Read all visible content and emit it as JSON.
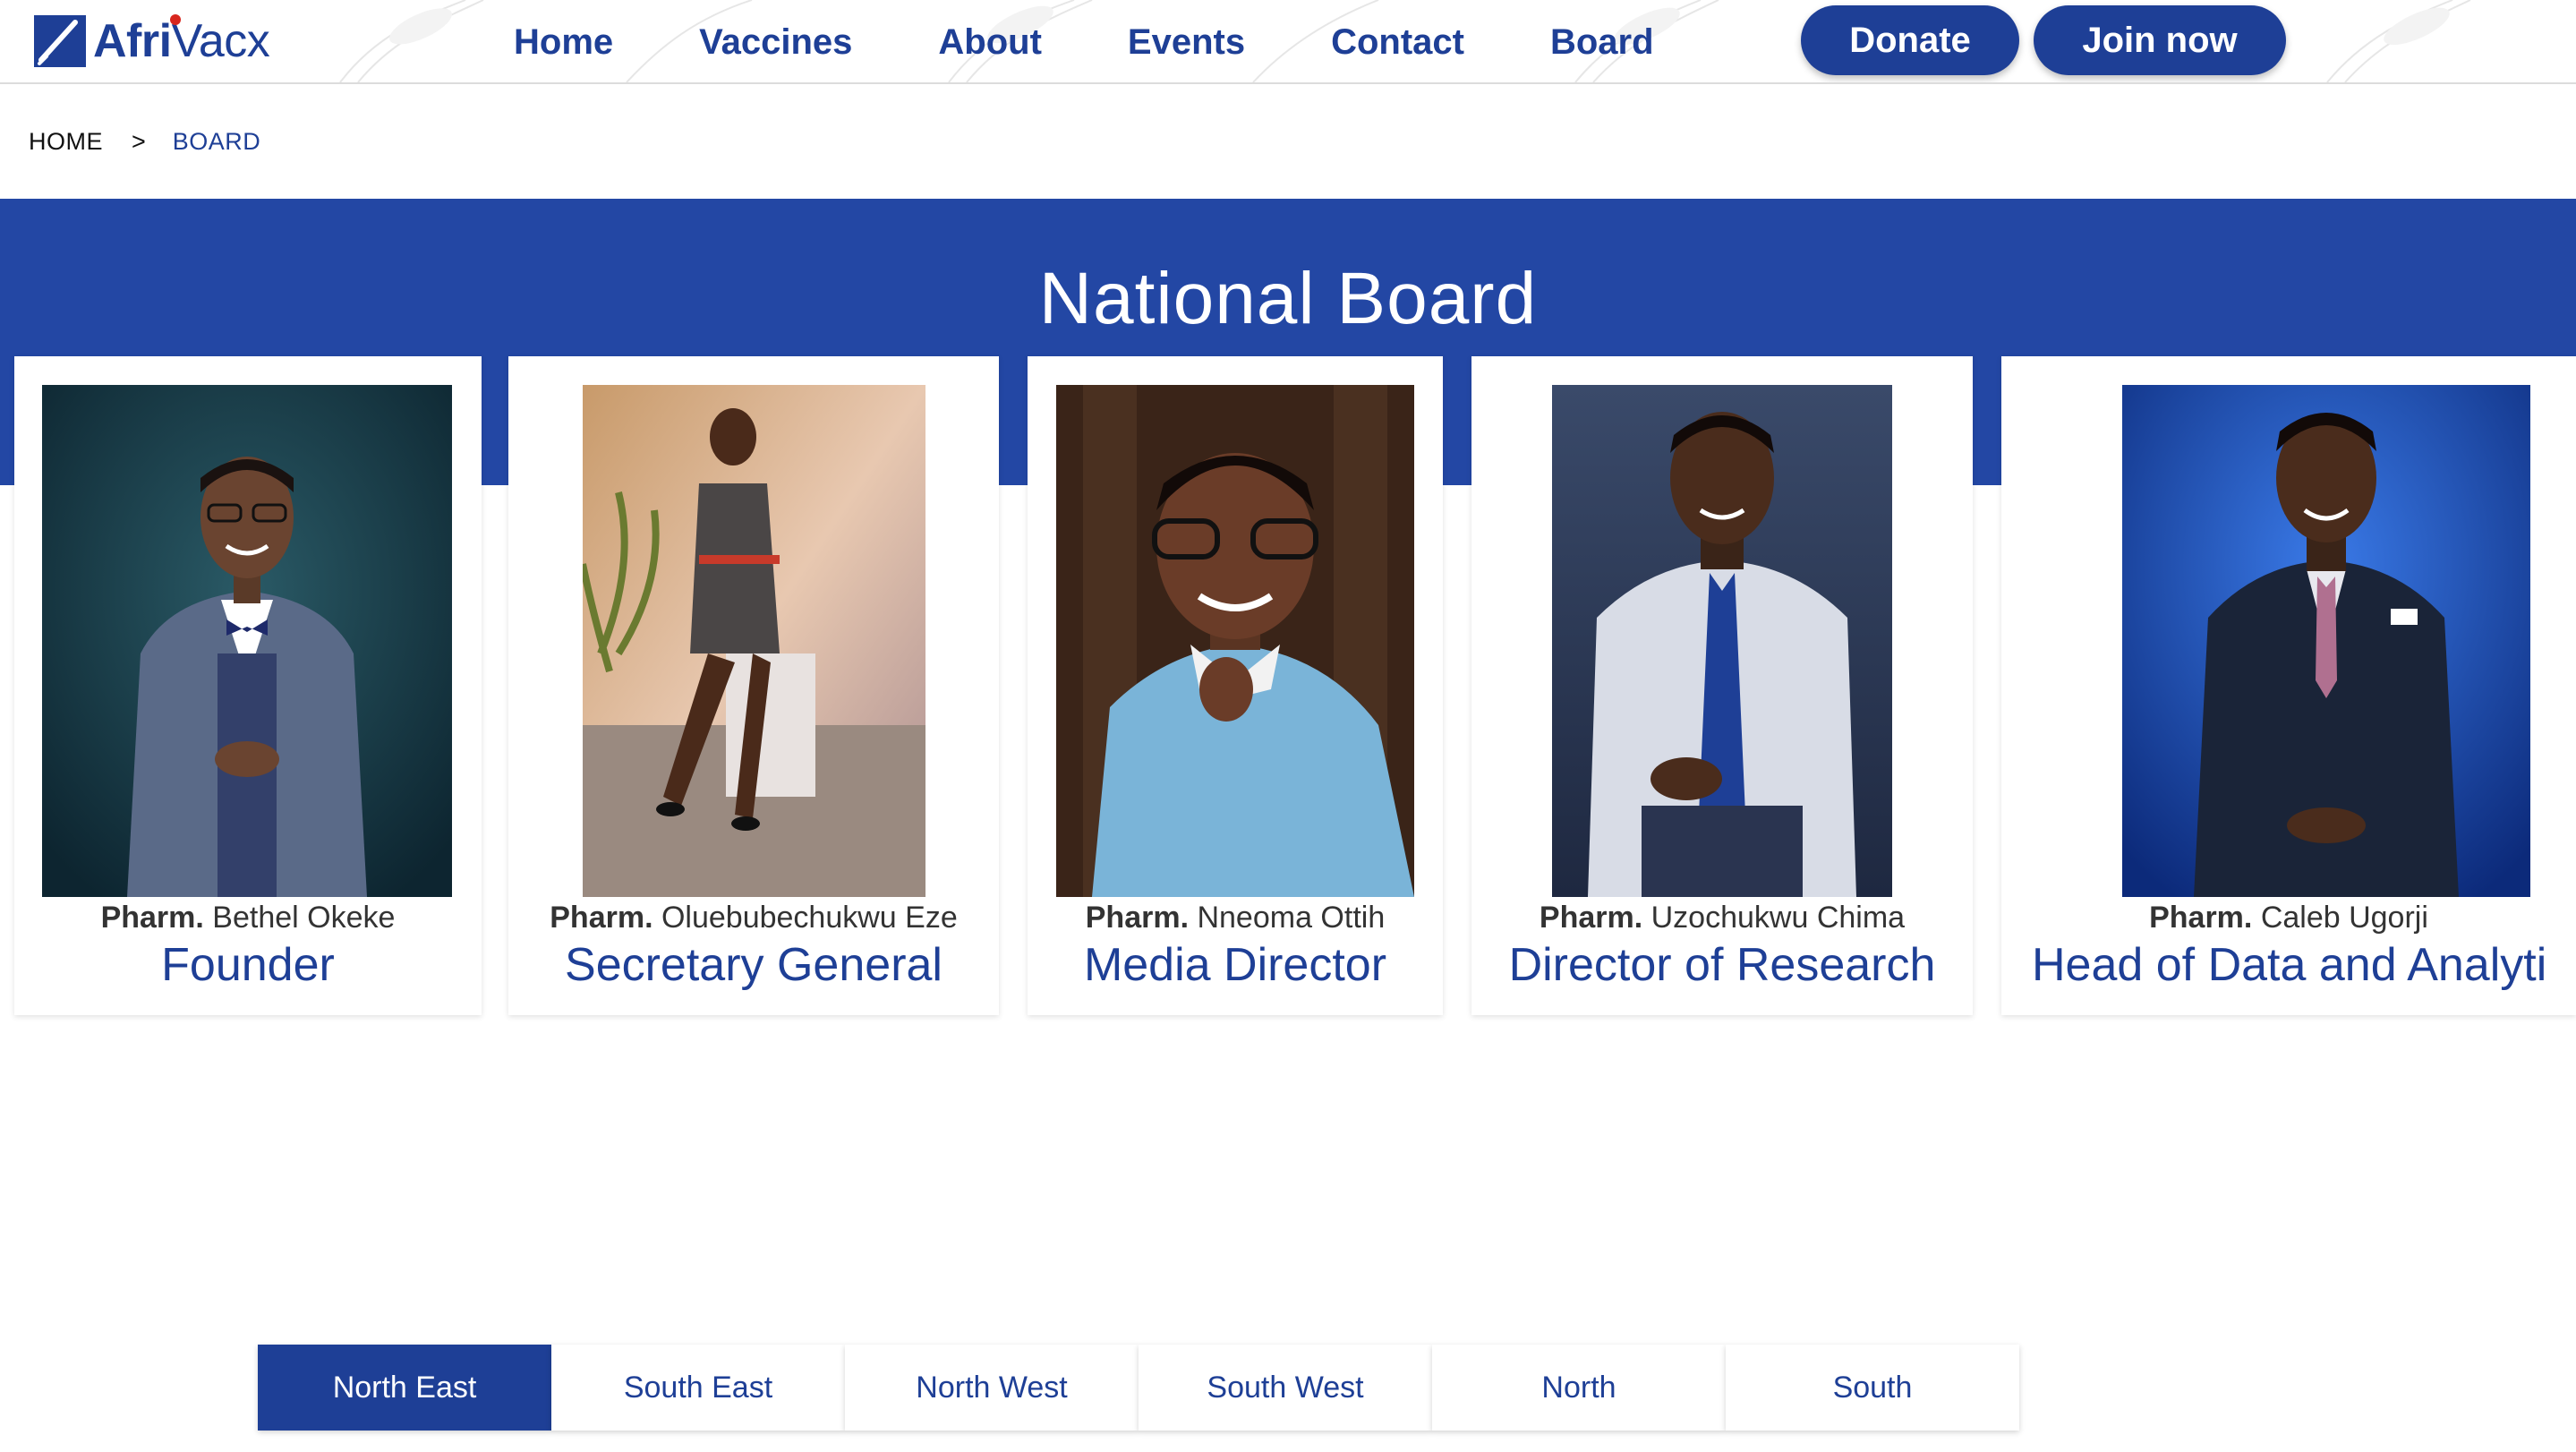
{
  "brand": {
    "name_bold": "Afri",
    "name_regular": "Vacx",
    "logo_icon": "syringe-logo-icon"
  },
  "nav": {
    "items": [
      {
        "label": "Home"
      },
      {
        "label": "Vaccines"
      },
      {
        "label": "About"
      },
      {
        "label": "Events"
      },
      {
        "label": "Contact"
      },
      {
        "label": "Board"
      }
    ],
    "donate": "Donate",
    "join": "Join now"
  },
  "breadcrumb": {
    "home": "HOME",
    "separator": ">",
    "current": "BOARD"
  },
  "banner": {
    "title": "National Board"
  },
  "members": [
    {
      "prefix": "Pharm.",
      "name": "Bethel Okeke",
      "role": "Founder"
    },
    {
      "prefix": "Pharm.",
      "name": "Oluebubechukwu Eze",
      "role": "Secretary General"
    },
    {
      "prefix": "Pharm.",
      "name": "Nneoma Ottih",
      "role": "Media Director"
    },
    {
      "prefix": "Pharm.",
      "name": "Uzochukwu Chima",
      "role": "Director of Research"
    },
    {
      "prefix": "Pharm.",
      "name": "Caleb Ugorji",
      "role": "Head of Data and Analyti"
    }
  ],
  "regions": {
    "tabs": [
      {
        "label": "North East",
        "active": true
      },
      {
        "label": "South East",
        "active": false
      },
      {
        "label": "North West",
        "active": false
      },
      {
        "label": "South West",
        "active": false
      },
      {
        "label": "North",
        "active": false
      },
      {
        "label": "South",
        "active": false
      }
    ]
  },
  "colors": {
    "brand_blue": "#1e3f96",
    "banner_blue": "#2347a4",
    "logo_red": "#d8261d"
  }
}
